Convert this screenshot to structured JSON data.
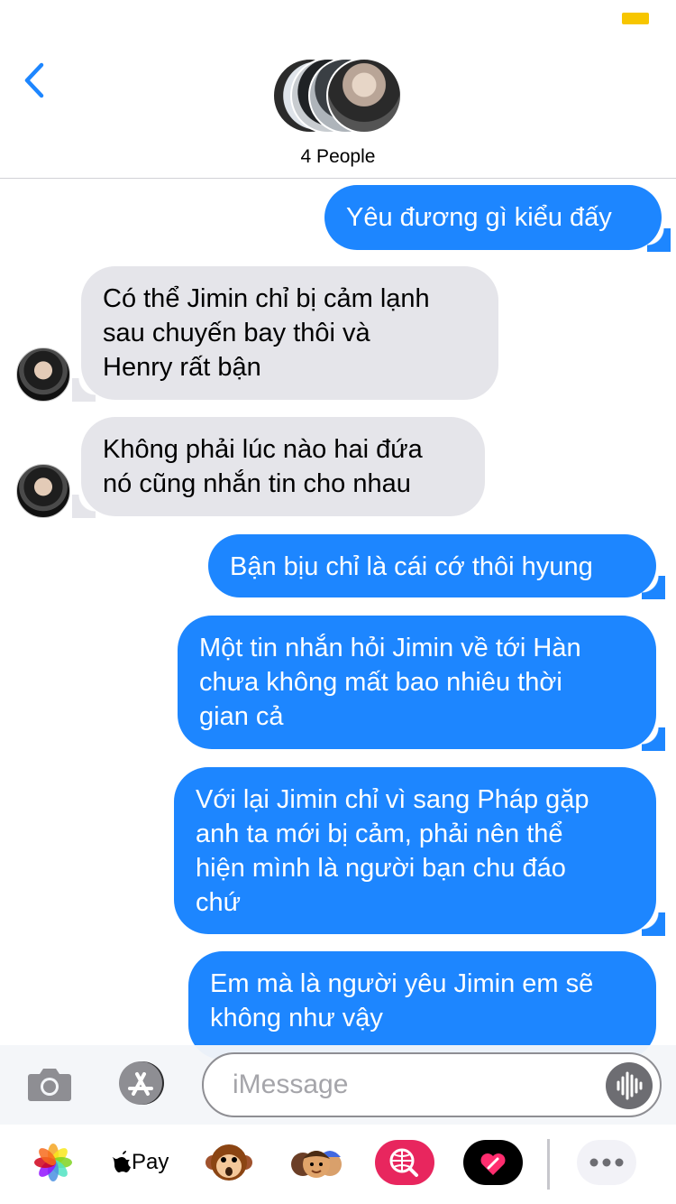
{
  "header": {
    "participants_label": "4 People"
  },
  "messages": [
    {
      "direction": "outgoing",
      "lines": [
        "Yêu đương gì kiểu đấy"
      ]
    },
    {
      "direction": "incoming",
      "lines": [
        "Có thể Jimin chỉ bị cảm lạnh",
        "sau chuyến bay thôi và",
        "Henry rất bận"
      ]
    },
    {
      "direction": "incoming",
      "lines": [
        "Không phải lúc nào hai đứa",
        "nó cũng nhắn tin cho nhau"
      ]
    },
    {
      "direction": "outgoing",
      "lines": [
        "Bận bịu chỉ là cái cớ thôi hyung"
      ]
    },
    {
      "direction": "outgoing",
      "lines": [
        "Một tin nhắn hỏi Jimin về tới Hàn",
        "chưa không mất bao nhiêu thời",
        "gian cả"
      ]
    },
    {
      "direction": "outgoing",
      "lines": [
        "Với lại Jimin chỉ vì sang Pháp gặp",
        "anh ta mới bị cảm, phải nên thể",
        "hiện mình là người bạn chu đáo",
        "chứ"
      ]
    },
    {
      "direction": "outgoing",
      "lines": [
        "Em mà là người yêu Jimin em sẽ",
        "không như vậy"
      ]
    }
  ],
  "input": {
    "placeholder": "iMessage"
  },
  "app_drawer": {
    "apple_pay_label": "Pay",
    "apps": [
      "photos-icon",
      "apple-pay-icon",
      "monkey-animoji-icon",
      "memoji-icon",
      "web-search-icon",
      "heart-digital-touch-icon",
      "more-icon"
    ]
  },
  "colors": {
    "accent": "#1d86ff",
    "incoming_bubble": "#e5e5ea",
    "battery": "#f7c600"
  }
}
